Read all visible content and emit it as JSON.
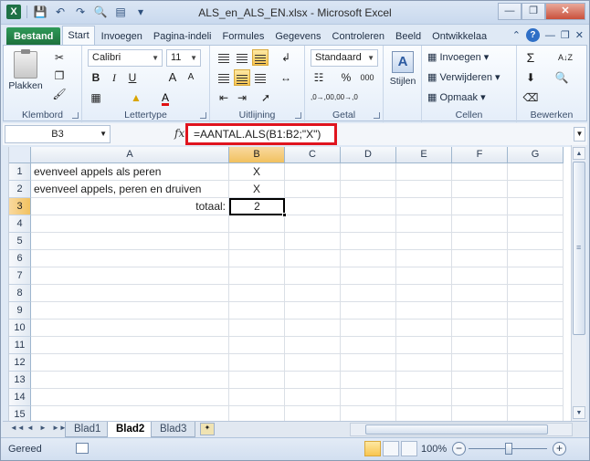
{
  "window": {
    "title": "ALS_en_ALS_EN.xlsx - Microsoft Excel",
    "app_icon": "X"
  },
  "tabs": [
    {
      "label": "Bestand"
    },
    {
      "label": "Start"
    },
    {
      "label": "Invoegen"
    },
    {
      "label": "Pagina-indeli"
    },
    {
      "label": "Formules"
    },
    {
      "label": "Gegevens"
    },
    {
      "label": "Controleren"
    },
    {
      "label": "Beeld"
    },
    {
      "label": "Ontwikkelaa"
    }
  ],
  "ribbon": {
    "clipboard": {
      "label": "Klembord",
      "paste": "Plakken"
    },
    "font": {
      "label": "Lettertype",
      "name": "Calibri",
      "size": "11",
      "bold": "B",
      "italic": "I",
      "underline": "U",
      "grow": "A",
      "shrink": "A",
      "color": "A"
    },
    "alignment": {
      "label": "Uitlijning"
    },
    "number": {
      "label": "Getal",
      "format": "Standaard",
      "percent": "%",
      "thousands": "000",
      "inc": ",0→,00",
      "dec": ",00→,0"
    },
    "styles": {
      "label": "Stijlen",
      "icon": "A"
    },
    "cells": {
      "label": "Cellen",
      "insert": "Invoegen",
      "delete": "Verwijderen",
      "format": "Opmaak"
    },
    "editing": {
      "label": "Bewerken",
      "sum": "Σ",
      "sort": "A↓Z"
    }
  },
  "formula_bar": {
    "name_box": "B3",
    "fx": "fx",
    "formula": "=AANTAL.ALS(B1:B2;\"X\")"
  },
  "sheet": {
    "columns": [
      "A",
      "B",
      "C",
      "D",
      "E",
      "F",
      "G"
    ],
    "rows": [
      "1",
      "2",
      "3",
      "4",
      "5",
      "6",
      "7",
      "8",
      "9",
      "10",
      "11",
      "12",
      "13",
      "14",
      "15"
    ],
    "cells": {
      "A1": "evenveel appels als peren",
      "B1": "X",
      "A2": "evenveel appels, peren en druiven",
      "B2": "X",
      "A3": "totaal:",
      "B3": "2"
    },
    "active_cell": "B3"
  },
  "sheet_tabs": [
    {
      "label": "Blad1"
    },
    {
      "label": "Blad2"
    },
    {
      "label": "Blad3"
    }
  ],
  "active_sheet": "Blad2",
  "status": {
    "text": "Gereed",
    "zoom": "100%",
    "zoom_minus": "−",
    "zoom_plus": "+"
  }
}
